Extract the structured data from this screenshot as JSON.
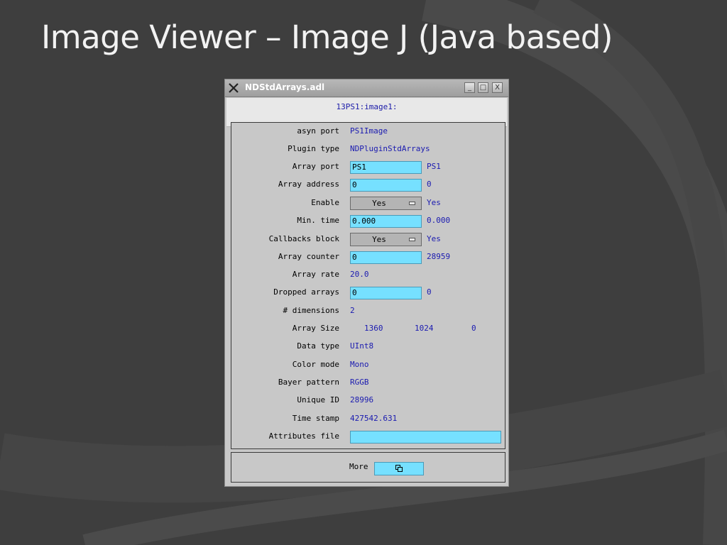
{
  "slide": {
    "title": "Image Viewer – Image J (Java based)"
  },
  "window": {
    "title": "NDStdArrays.adl",
    "buttons": {
      "minimize": "_",
      "maximize": "□",
      "close": "X"
    },
    "prefix": "13PS1:image1:"
  },
  "fields": {
    "asyn_port": {
      "label": "asyn port",
      "value": "PS1Image"
    },
    "plugin_type": {
      "label": "Plugin type",
      "value": "NDPluginStdArrays"
    },
    "array_port": {
      "label": "Array port",
      "input": "PS1",
      "readback": "PS1"
    },
    "array_address": {
      "label": "Array address",
      "input": "0",
      "readback": "0"
    },
    "enable": {
      "label": "Enable",
      "menu": "Yes",
      "readback": "Yes"
    },
    "min_time": {
      "label": "Min. time",
      "input": "0.000",
      "readback": "0.000"
    },
    "callbacks_block": {
      "label": "Callbacks block",
      "menu": "Yes",
      "readback": "Yes"
    },
    "array_counter": {
      "label": "Array counter",
      "input": "0",
      "readback": "28959"
    },
    "array_rate": {
      "label": "Array rate",
      "value": "20.0"
    },
    "dropped_arrays": {
      "label": "Dropped arrays",
      "input": "0",
      "readback": "0"
    },
    "dimensions": {
      "label": "# dimensions",
      "value": "2"
    },
    "array_size": {
      "label": "Array Size",
      "values": [
        "1360",
        "1024",
        "0"
      ]
    },
    "data_type": {
      "label": "Data type",
      "value": "UInt8"
    },
    "color_mode": {
      "label": "Color mode",
      "value": "Mono"
    },
    "bayer_pattern": {
      "label": "Bayer pattern",
      "value": "RGGB"
    },
    "unique_id": {
      "label": "Unique ID",
      "value": "28996"
    },
    "time_stamp": {
      "label": "Time stamp",
      "value": "427542.631"
    },
    "attributes_file": {
      "label": "Attributes file",
      "input": ""
    }
  },
  "more": {
    "label": "More"
  },
  "colors": {
    "input_bg": "#76e0ff",
    "readback_text": "#1a1ab0",
    "slide_bg": "#3e3e3e"
  }
}
